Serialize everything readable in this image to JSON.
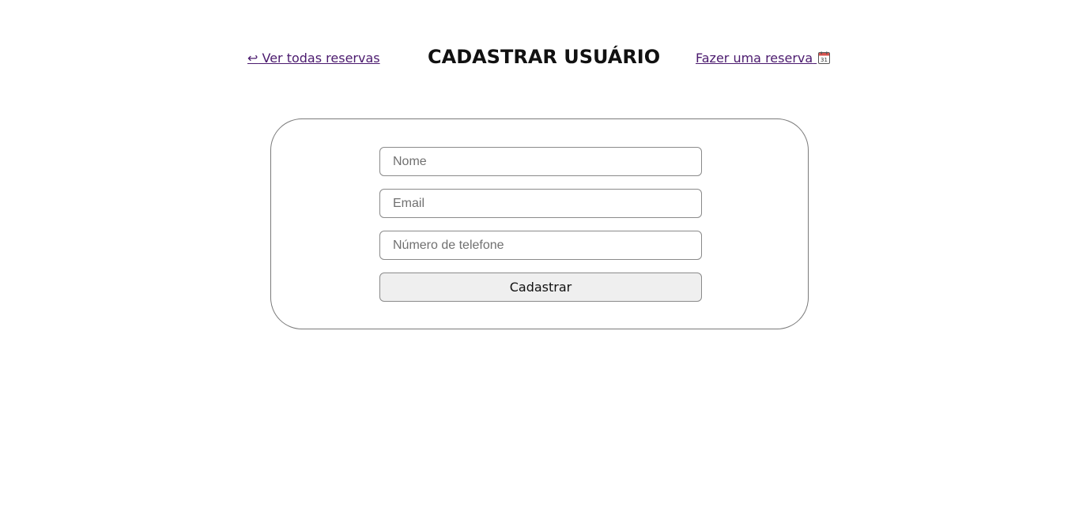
{
  "header": {
    "back_link": {
      "icon": "return-arrow-icon",
      "icon_glyph": "↩",
      "label": "Ver todas reservas"
    },
    "title": "CADASTRAR USUÁRIO",
    "reserve_link": {
      "label": "Fazer uma reserva",
      "icon": "calendar-icon",
      "icon_text": "31"
    }
  },
  "form": {
    "name_placeholder": "Nome",
    "email_placeholder": "Email",
    "phone_placeholder": "Número de telefone",
    "submit_label": "Cadastrar"
  },
  "colors": {
    "link": "#4b1a6e",
    "title": "#111111",
    "border": "#8a8a8a",
    "button_bg": "#efefef",
    "calendar_top": "#d9534f"
  }
}
